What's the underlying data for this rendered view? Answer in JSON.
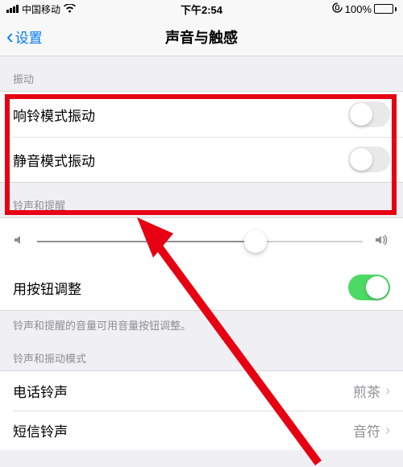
{
  "status": {
    "carrier": "中国移动",
    "time": "下午2:54",
    "battery_pct": "100%"
  },
  "nav": {
    "back_label": "设置",
    "title": "声音与触感"
  },
  "sections": {
    "vibrate": {
      "header": "振动",
      "ring_label": "响铃模式振动",
      "silent_label": "静音模式振动"
    },
    "ringer": {
      "header": "铃声和提醒",
      "button_label": "用按钮调整",
      "footer": "铃声和提醒的音量可用音量按钮调整。"
    },
    "patterns": {
      "header": "铃声和振动模式",
      "phone_label": "电话铃声",
      "phone_value": "煎茶",
      "sms_label": "短信铃声",
      "sms_value": "音符"
    }
  }
}
